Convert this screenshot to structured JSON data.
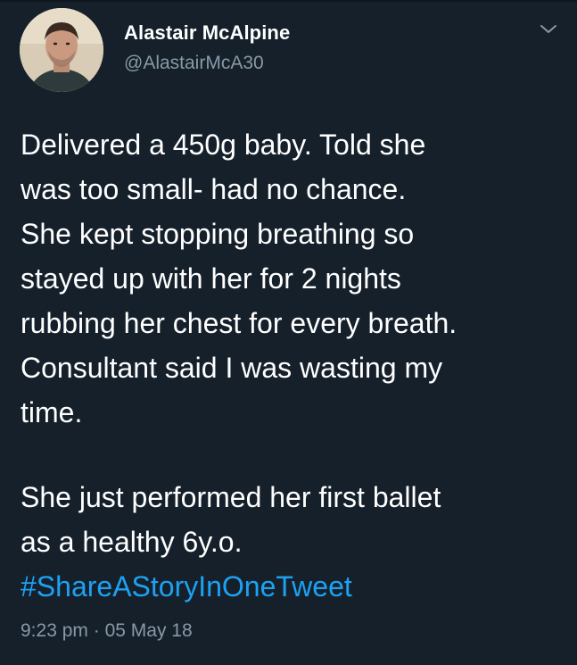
{
  "tweet": {
    "display_name": "Alastair McAlpine",
    "handle": "@AlastairMcA30",
    "text_paragraph_1": "Delivered a 450g baby. Told she\nwas too small- had no chance.\nShe kept stopping breathing so\nstayed up with her for 2 nights\nrubbing her chest for every breath.\nConsultant said I was wasting my\ntime.",
    "text_paragraph_2_line_1": "She just performed her first ballet",
    "text_paragraph_2_line_2": "as a healthy 6y.o.",
    "hashtag": "#ShareAStoryInOneTweet",
    "time": "9:23 pm",
    "separator": "·",
    "date": "05 May 18"
  },
  "icons": {
    "menu": "chevron-down-icon",
    "avatar": "profile-photo"
  },
  "colors": {
    "background": "#15202b",
    "text": "#ffffff",
    "secondary_text": "#8899a6",
    "link": "#1da1f2"
  }
}
